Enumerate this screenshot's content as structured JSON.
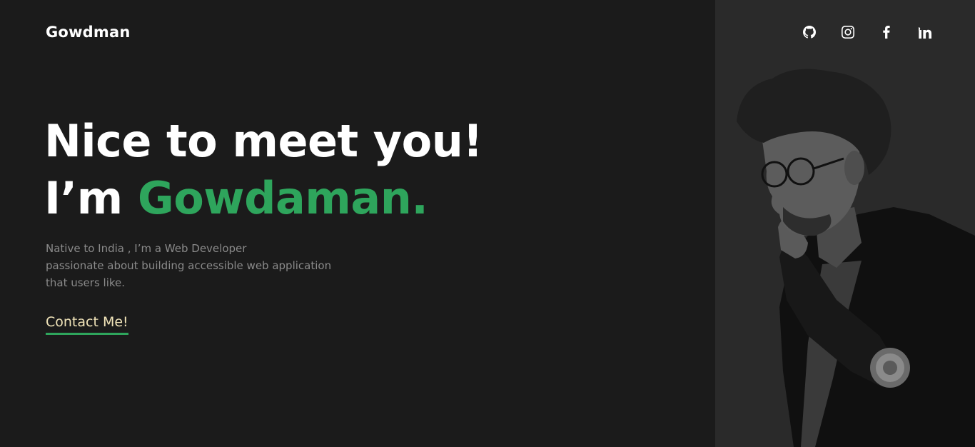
{
  "brand": {
    "name": "Gowdman"
  },
  "socials": [
    {
      "icon": "github-icon"
    },
    {
      "icon": "instagram-icon"
    },
    {
      "icon": "facebook-icon"
    },
    {
      "icon": "linkedin-icon"
    }
  ],
  "hero": {
    "line1": "Nice to meet you!",
    "line2_prefix": "I’m ",
    "line2_name": "Gowdaman."
  },
  "intro": {
    "line1": "Native to India , I’m a Web Developer",
    "line2": "passionate about building accessible web application",
    "line3": "that users like."
  },
  "contact": {
    "label": "Contact Me!"
  },
  "colors": {
    "background": "#1b1b1b",
    "panel": "#2a2a2a",
    "accent": "#2ea55c",
    "contact_text": "#f1e4b9",
    "muted_text": "#8a8a8a"
  }
}
